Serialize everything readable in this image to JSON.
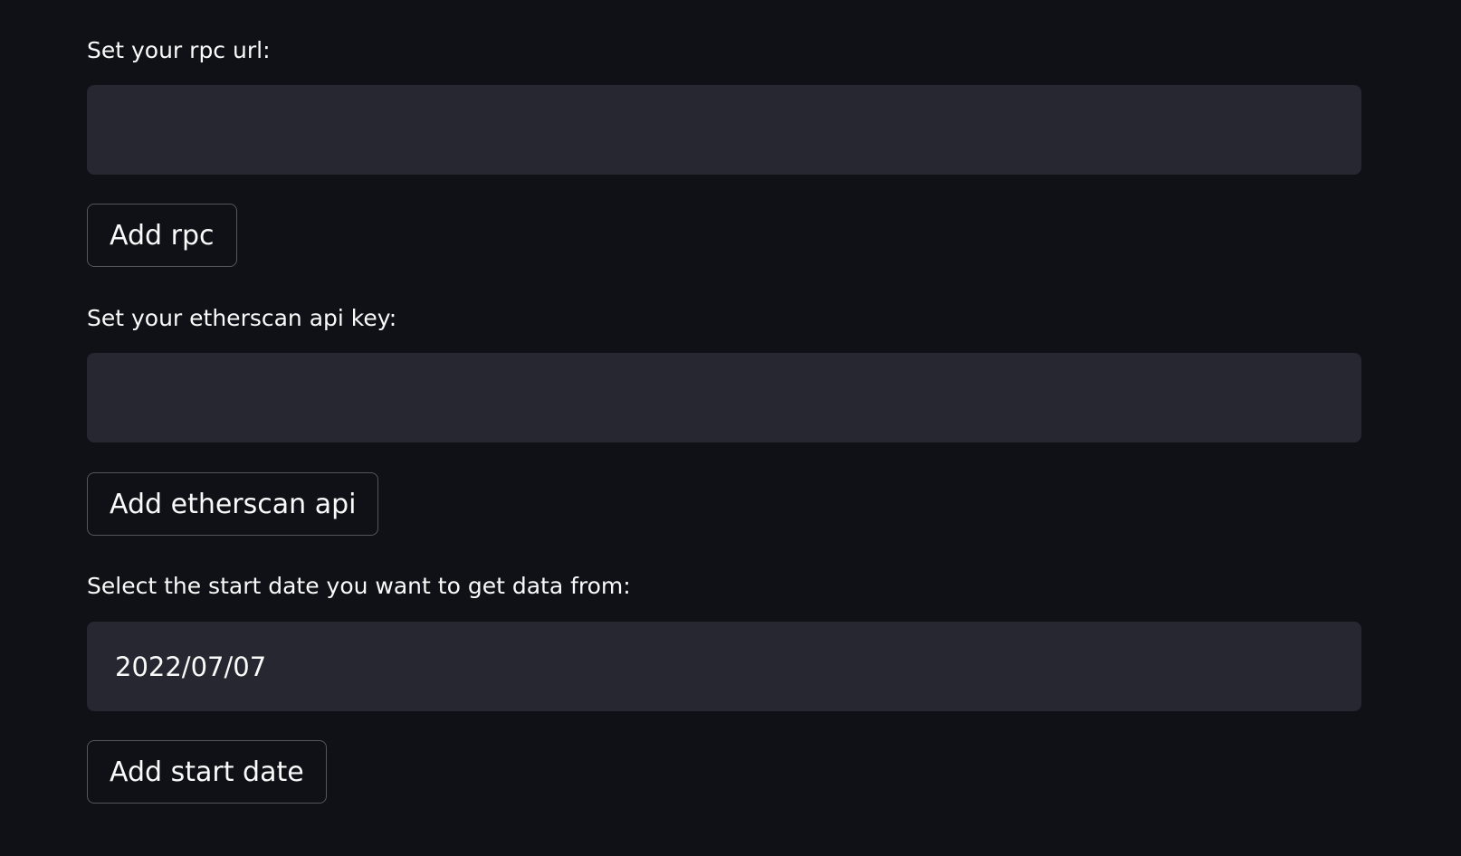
{
  "rpc": {
    "label": "Set your rpc url:",
    "value": "",
    "button_label": "Add rpc"
  },
  "etherscan": {
    "label": "Set your etherscan api key:",
    "value": "",
    "button_label": "Add etherscan api"
  },
  "start_date": {
    "label": "Select the start date you want to get data from:",
    "value": "2022/07/07",
    "button_label": "Add start date"
  }
}
